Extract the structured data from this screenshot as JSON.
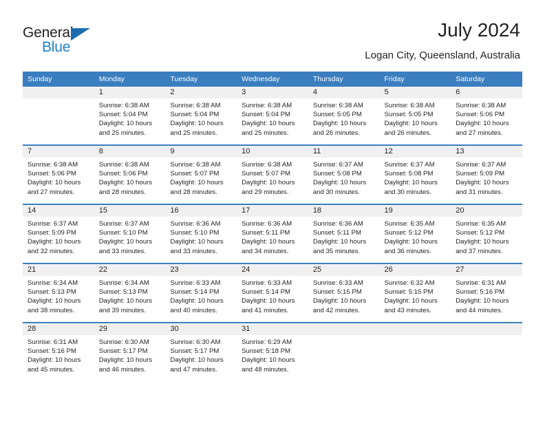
{
  "brand": {
    "name_part1": "General",
    "name_part2": "Blue"
  },
  "header": {
    "title": "July 2024",
    "subtitle": "Logan City, Queensland, Australia"
  },
  "colors": {
    "header_blue": "#3a7ebf",
    "logo_blue": "#1c7fd0",
    "daynum_band": "#f0f0f0",
    "text": "#231f20"
  },
  "weekday_headers": [
    "Sunday",
    "Monday",
    "Tuesday",
    "Wednesday",
    "Thursday",
    "Friday",
    "Saturday"
  ],
  "labels": {
    "sunrise_prefix": "Sunrise: ",
    "sunset_prefix": "Sunset: ",
    "daylight_prefix": "Daylight: "
  },
  "weeks": [
    [
      {
        "day": "",
        "blank": true,
        "sunrise": "",
        "sunset": "",
        "daylight_line1": "",
        "daylight_line2": ""
      },
      {
        "day": "1",
        "sunrise": "Sunrise: 6:38 AM",
        "sunset": "Sunset: 5:04 PM",
        "daylight_line1": "Daylight: 10 hours",
        "daylight_line2": "and 25 minutes."
      },
      {
        "day": "2",
        "sunrise": "Sunrise: 6:38 AM",
        "sunset": "Sunset: 5:04 PM",
        "daylight_line1": "Daylight: 10 hours",
        "daylight_line2": "and 25 minutes."
      },
      {
        "day": "3",
        "sunrise": "Sunrise: 6:38 AM",
        "sunset": "Sunset: 5:04 PM",
        "daylight_line1": "Daylight: 10 hours",
        "daylight_line2": "and 25 minutes."
      },
      {
        "day": "4",
        "sunrise": "Sunrise: 6:38 AM",
        "sunset": "Sunset: 5:05 PM",
        "daylight_line1": "Daylight: 10 hours",
        "daylight_line2": "and 26 minutes."
      },
      {
        "day": "5",
        "sunrise": "Sunrise: 6:38 AM",
        "sunset": "Sunset: 5:05 PM",
        "daylight_line1": "Daylight: 10 hours",
        "daylight_line2": "and 26 minutes."
      },
      {
        "day": "6",
        "sunrise": "Sunrise: 6:38 AM",
        "sunset": "Sunset: 5:06 PM",
        "daylight_line1": "Daylight: 10 hours",
        "daylight_line2": "and 27 minutes."
      }
    ],
    [
      {
        "day": "7",
        "sunrise": "Sunrise: 6:38 AM",
        "sunset": "Sunset: 5:06 PM",
        "daylight_line1": "Daylight: 10 hours",
        "daylight_line2": "and 27 minutes."
      },
      {
        "day": "8",
        "sunrise": "Sunrise: 6:38 AM",
        "sunset": "Sunset: 5:06 PM",
        "daylight_line1": "Daylight: 10 hours",
        "daylight_line2": "and 28 minutes."
      },
      {
        "day": "9",
        "sunrise": "Sunrise: 6:38 AM",
        "sunset": "Sunset: 5:07 PM",
        "daylight_line1": "Daylight: 10 hours",
        "daylight_line2": "and 28 minutes."
      },
      {
        "day": "10",
        "sunrise": "Sunrise: 6:38 AM",
        "sunset": "Sunset: 5:07 PM",
        "daylight_line1": "Daylight: 10 hours",
        "daylight_line2": "and 29 minutes."
      },
      {
        "day": "11",
        "sunrise": "Sunrise: 6:37 AM",
        "sunset": "Sunset: 5:08 PM",
        "daylight_line1": "Daylight: 10 hours",
        "daylight_line2": "and 30 minutes."
      },
      {
        "day": "12",
        "sunrise": "Sunrise: 6:37 AM",
        "sunset": "Sunset: 5:08 PM",
        "daylight_line1": "Daylight: 10 hours",
        "daylight_line2": "and 30 minutes."
      },
      {
        "day": "13",
        "sunrise": "Sunrise: 6:37 AM",
        "sunset": "Sunset: 5:09 PM",
        "daylight_line1": "Daylight: 10 hours",
        "daylight_line2": "and 31 minutes."
      }
    ],
    [
      {
        "day": "14",
        "sunrise": "Sunrise: 6:37 AM",
        "sunset": "Sunset: 5:09 PM",
        "daylight_line1": "Daylight: 10 hours",
        "daylight_line2": "and 32 minutes."
      },
      {
        "day": "15",
        "sunrise": "Sunrise: 6:37 AM",
        "sunset": "Sunset: 5:10 PM",
        "daylight_line1": "Daylight: 10 hours",
        "daylight_line2": "and 33 minutes."
      },
      {
        "day": "16",
        "sunrise": "Sunrise: 6:36 AM",
        "sunset": "Sunset: 5:10 PM",
        "daylight_line1": "Daylight: 10 hours",
        "daylight_line2": "and 33 minutes."
      },
      {
        "day": "17",
        "sunrise": "Sunrise: 6:36 AM",
        "sunset": "Sunset: 5:11 PM",
        "daylight_line1": "Daylight: 10 hours",
        "daylight_line2": "and 34 minutes."
      },
      {
        "day": "18",
        "sunrise": "Sunrise: 6:36 AM",
        "sunset": "Sunset: 5:11 PM",
        "daylight_line1": "Daylight: 10 hours",
        "daylight_line2": "and 35 minutes."
      },
      {
        "day": "19",
        "sunrise": "Sunrise: 6:35 AM",
        "sunset": "Sunset: 5:12 PM",
        "daylight_line1": "Daylight: 10 hours",
        "daylight_line2": "and 36 minutes."
      },
      {
        "day": "20",
        "sunrise": "Sunrise: 6:35 AM",
        "sunset": "Sunset: 5:12 PM",
        "daylight_line1": "Daylight: 10 hours",
        "daylight_line2": "and 37 minutes."
      }
    ],
    [
      {
        "day": "21",
        "sunrise": "Sunrise: 6:34 AM",
        "sunset": "Sunset: 5:13 PM",
        "daylight_line1": "Daylight: 10 hours",
        "daylight_line2": "and 38 minutes."
      },
      {
        "day": "22",
        "sunrise": "Sunrise: 6:34 AM",
        "sunset": "Sunset: 5:13 PM",
        "daylight_line1": "Daylight: 10 hours",
        "daylight_line2": "and 39 minutes."
      },
      {
        "day": "23",
        "sunrise": "Sunrise: 6:33 AM",
        "sunset": "Sunset: 5:14 PM",
        "daylight_line1": "Daylight: 10 hours",
        "daylight_line2": "and 40 minutes."
      },
      {
        "day": "24",
        "sunrise": "Sunrise: 6:33 AM",
        "sunset": "Sunset: 5:14 PM",
        "daylight_line1": "Daylight: 10 hours",
        "daylight_line2": "and 41 minutes."
      },
      {
        "day": "25",
        "sunrise": "Sunrise: 6:33 AM",
        "sunset": "Sunset: 5:15 PM",
        "daylight_line1": "Daylight: 10 hours",
        "daylight_line2": "and 42 minutes."
      },
      {
        "day": "26",
        "sunrise": "Sunrise: 6:32 AM",
        "sunset": "Sunset: 5:15 PM",
        "daylight_line1": "Daylight: 10 hours",
        "daylight_line2": "and 43 minutes."
      },
      {
        "day": "27",
        "sunrise": "Sunrise: 6:31 AM",
        "sunset": "Sunset: 5:16 PM",
        "daylight_line1": "Daylight: 10 hours",
        "daylight_line2": "and 44 minutes."
      }
    ],
    [
      {
        "day": "28",
        "sunrise": "Sunrise: 6:31 AM",
        "sunset": "Sunset: 5:16 PM",
        "daylight_line1": "Daylight: 10 hours",
        "daylight_line2": "and 45 minutes."
      },
      {
        "day": "29",
        "sunrise": "Sunrise: 6:30 AM",
        "sunset": "Sunset: 5:17 PM",
        "daylight_line1": "Daylight: 10 hours",
        "daylight_line2": "and 46 minutes."
      },
      {
        "day": "30",
        "sunrise": "Sunrise: 6:30 AM",
        "sunset": "Sunset: 5:17 PM",
        "daylight_line1": "Daylight: 10 hours",
        "daylight_line2": "and 47 minutes."
      },
      {
        "day": "31",
        "sunrise": "Sunrise: 6:29 AM",
        "sunset": "Sunset: 5:18 PM",
        "daylight_line1": "Daylight: 10 hours",
        "daylight_line2": "and 48 minutes."
      },
      {
        "day": "",
        "blank": true,
        "sunrise": "",
        "sunset": "",
        "daylight_line1": "",
        "daylight_line2": ""
      },
      {
        "day": "",
        "blank": true,
        "sunrise": "",
        "sunset": "",
        "daylight_line1": "",
        "daylight_line2": ""
      },
      {
        "day": "",
        "blank": true,
        "sunrise": "",
        "sunset": "",
        "daylight_line1": "",
        "daylight_line2": ""
      }
    ]
  ]
}
